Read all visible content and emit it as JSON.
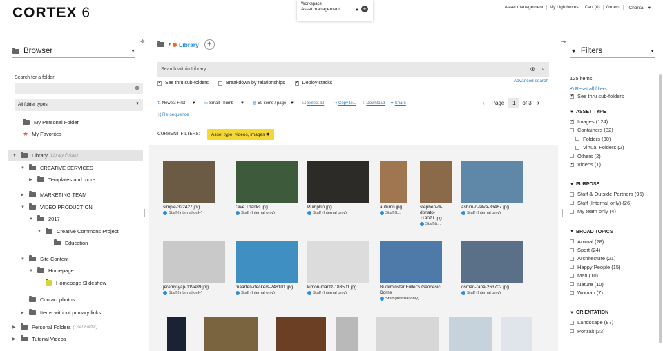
{
  "app": {
    "logo": "CORTEX",
    "version": "6"
  },
  "workspace": {
    "label": "Workspace",
    "value": "Asset management"
  },
  "topnav": [
    "Asset management",
    "My Lightboxes",
    "Cart (0)",
    "Orders",
    "Chantal"
  ],
  "left": {
    "title": "Browser",
    "search_label": "Search for a folder",
    "folder_types": "All folder types",
    "shortcuts": [
      "My Personal Folder",
      "My Favorites"
    ],
    "tree": [
      {
        "label": "Library",
        "note": "(Library Folder)",
        "level": 0,
        "exp": "open"
      },
      {
        "label": "CREATIVE SERVICES",
        "level": 1,
        "exp": "open"
      },
      {
        "label": "Templates and more",
        "level": 2,
        "exp": "closed"
      },
      {
        "label": "MARKETING TEAM",
        "level": 1,
        "exp": "closed"
      },
      {
        "label": "VIDEO PRODUCTION",
        "level": 1,
        "exp": "open"
      },
      {
        "label": "2017",
        "level": 2,
        "exp": "open"
      },
      {
        "label": "Creative Commons Project",
        "level": 3,
        "exp": "open"
      },
      {
        "label": "Education",
        "level": 4,
        "exp": "none"
      },
      {
        "label": "Site Content",
        "level": 1,
        "exp": "open"
      },
      {
        "label": "Homepage",
        "level": 2,
        "exp": "open"
      },
      {
        "label": "Homepage Slideshow",
        "level": 3,
        "exp": "none",
        "yellow": true
      },
      {
        "label": "Contact photos",
        "level": 1,
        "exp": "none"
      },
      {
        "label": "Items without primary links",
        "level": 1,
        "exp": "closed"
      },
      {
        "label": "Personal Folders",
        "note": "(User Folder)",
        "level": 0,
        "exp": "closed"
      },
      {
        "label": "Tutorial Videos",
        "level": 0,
        "exp": "closed"
      }
    ]
  },
  "main": {
    "breadcrumb": "Library",
    "search_placeholder": "Search within Library",
    "opt1": "See thru sub-folders",
    "opt2": "Breakdown by relationships",
    "opt3": "Deploy stacks",
    "advanced": "Advanced search",
    "sort": "Newest First",
    "thumb_size": "Small Thumb",
    "per_page": "50 items / page",
    "select_all": "Select all",
    "copy_to": "Copy to...",
    "download": "Download",
    "share": "Share",
    "page_label": "Page",
    "page": "1",
    "of_pages": "of 3",
    "resequence": "Re-sequence",
    "current_filters_label": "CURRENT FILTERS:",
    "filter_chip": "Asset type: videos, images",
    "assets": [
      {
        "name": "simple-322427.jpg",
        "badge": "Staff (Internal only)",
        "color": "#6b5a44"
      },
      {
        "name": "Give Thanks.jpg",
        "badge": "Staff (Internal only)",
        "color": "#3d5a3a"
      },
      {
        "name": "Pumpkin.jpg",
        "badge": "Staff (Internal only)",
        "color": "#2d2b28"
      },
      {
        "name": "autumn.jpg",
        "badge": "Staff (I...",
        "color": "#a07650"
      },
      {
        "name": "stephen-di-donato-119071.jpg",
        "badge": "Staff &...",
        "color": "#8b6a4a"
      },
      {
        "name": "ashim-d-silva-83467.jpg",
        "badge": "Staff (Internal only)",
        "color": "#5f87a8"
      },
      {
        "name": "jeremy-yap-119489.jpg",
        "badge": "Staff (Internal only)",
        "color": "#c9c9c9"
      },
      {
        "name": "maarten-deckers-248101.jpg",
        "badge": "Staff (Internal only)",
        "color": "#3f8fc2"
      },
      {
        "name": "kimon-maritz-183501.jpg",
        "badge": "Staff (Internal only)",
        "color": "#dcdcdc"
      },
      {
        "name": "Buckminster Fuller's Geodesic Dome",
        "badge": "Staff (Internal only)",
        "color": "#4d7aa8"
      },
      {
        "name": "osman-rana-263702.jpg",
        "badge": "Staff (Internal only)",
        "color": "#5a7088"
      }
    ]
  },
  "right": {
    "title": "Filters",
    "count": "125 items",
    "reset": "Reset all filters",
    "see_thru": "See thru sub-folders",
    "sections": [
      {
        "title": "ASSET TYPE",
        "items": [
          {
            "label": "Images (124)",
            "checked": true
          },
          {
            "label": "Containers (32)",
            "checked": false
          },
          {
            "label": "Folders (30)",
            "checked": false,
            "indent": true
          },
          {
            "label": "Virtual Folders (2)",
            "checked": false,
            "indent": true
          },
          {
            "label": "Others (2)",
            "checked": false
          },
          {
            "label": "Videos (1)",
            "checked": true
          }
        ]
      },
      {
        "title": "PURPOSE",
        "items": [
          {
            "label": "Staff & Outside Partners (95)",
            "checked": false
          },
          {
            "label": "Staff (Internal only) (26)",
            "checked": false
          },
          {
            "label": "My team only (4)",
            "checked": false
          }
        ]
      },
      {
        "title": "BROAD TOPICS",
        "items": [
          {
            "label": "Animal (28)",
            "checked": false
          },
          {
            "label": "Sport (24)",
            "checked": false
          },
          {
            "label": "Architecture (21)",
            "checked": false
          },
          {
            "label": "Happy People (15)",
            "checked": false
          },
          {
            "label": "Man (10)",
            "checked": false
          },
          {
            "label": "Nature (10)",
            "checked": false
          },
          {
            "label": "Woman (7)",
            "checked": false
          }
        ]
      },
      {
        "title": "ORIENTATION",
        "items": [
          {
            "label": "Landscape (87)",
            "checked": false
          },
          {
            "label": "Portrait (33)",
            "checked": false
          }
        ]
      }
    ]
  }
}
